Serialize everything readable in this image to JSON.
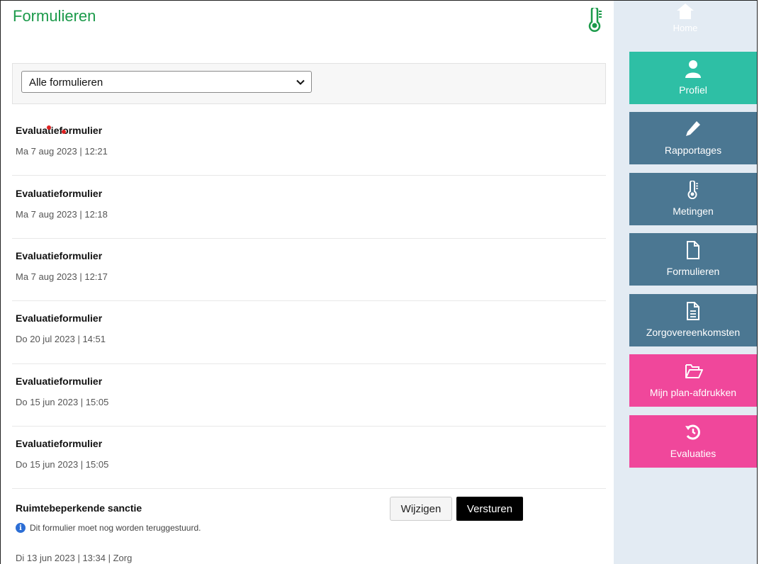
{
  "page": {
    "title": "Formulieren"
  },
  "filter": {
    "selected": "Alle formulieren"
  },
  "forms": [
    {
      "title": "Evaluatieformulier",
      "date": "Ma 7 aug 2023 | 12:21"
    },
    {
      "title": "Evaluatieformulier",
      "date": "Ma 7 aug 2023 | 12:18"
    },
    {
      "title": "Evaluatieformulier",
      "date": "Ma 7 aug 2023 | 12:17"
    },
    {
      "title": "Evaluatieformulier",
      "date": "Do 20 jul 2023 | 14:51"
    },
    {
      "title": "Evaluatieformulier",
      "date": "Do 15 jun 2023 | 15:05"
    },
    {
      "title": "Evaluatieformulier",
      "date": "Do 15 jun 2023 | 15:05"
    },
    {
      "title": "Ruimtebeperkende sanctie",
      "notice": "Dit formulier moet nog worden teruggestuurd.",
      "date": "Di 13 jun 2023 | 13:34 | Zorg",
      "edit_label": "Wijzigen",
      "send_label": "Versturen"
    }
  ],
  "sidebar": {
    "home": {
      "label": "Home",
      "icon": "home-icon"
    },
    "items": [
      {
        "label": "Profiel",
        "icon": "user-icon",
        "color": "#2ebfa5"
      },
      {
        "label": "Rapportages",
        "icon": "pencil-icon",
        "color": "#4b7792"
      },
      {
        "label": "Metingen",
        "icon": "thermometer-icon",
        "color": "#4b7792"
      },
      {
        "label": "Formulieren",
        "icon": "file-icon",
        "color": "#4b7792"
      },
      {
        "label": "Zorgovereenkomsten",
        "icon": "document-icon",
        "color": "#4b7792"
      },
      {
        "label": "Mijn plan-afdrukken",
        "icon": "folder-open-icon",
        "color": "#f0479b"
      },
      {
        "label": "Evaluaties",
        "icon": "history-icon",
        "color": "#f0479b"
      }
    ]
  },
  "colors": {
    "accent_green": "#1b9a4a",
    "teal": "#2ebfa5",
    "slate": "#4b7792",
    "pink": "#f0479b"
  }
}
